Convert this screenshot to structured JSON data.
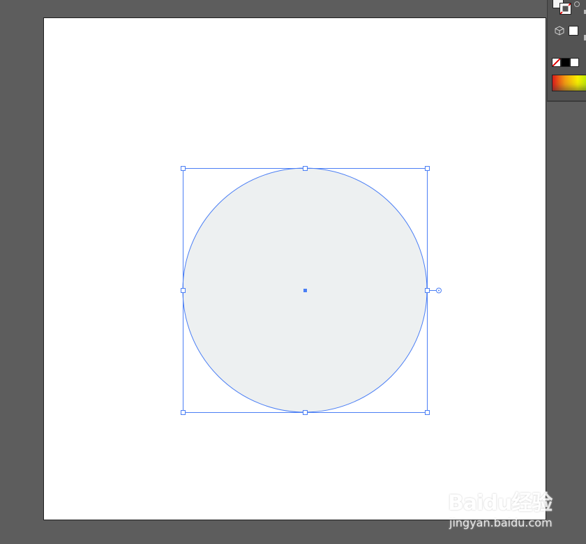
{
  "canvas": {
    "workspace_bg": "#5d5d5d",
    "artboard_bg": "#ffffff",
    "shape_fill": "#edf0f1",
    "selection_color": "#4a7ef5"
  },
  "shape": {
    "type": "ellipse",
    "name": "circle"
  },
  "toolbar": {
    "fill_icon": "fill-swatch-icon",
    "stroke_icon": "stroke-none-icon",
    "cube_icon": "3d-cube-icon",
    "colors": [
      "none",
      "#000000",
      "#ffffff"
    ],
    "gradient_colors": [
      "#e11b1b",
      "#f39c12",
      "#f7f000",
      "#a4e20a"
    ]
  },
  "watermark": {
    "logo": "Baidu经验",
    "url": "jingyan.baidu.com"
  }
}
